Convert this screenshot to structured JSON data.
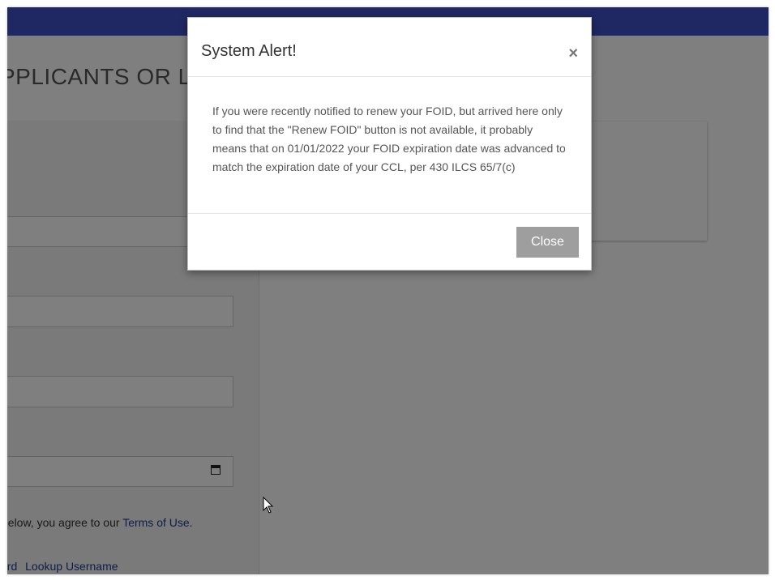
{
  "page": {
    "heading": "PPLICANTS OR L",
    "terms_prefix": "below, you agree to our ",
    "terms_link": "Terms of Use",
    "terms_suffix": ".",
    "link_password": "ord",
    "link_username": "Lookup Username"
  },
  "modal": {
    "title": "System Alert!",
    "close_x": "×",
    "body": "If you were recently notified to renew your FOID, but arrived here only to find that the \"Renew FOID\" button is not available, it probably means that on 01/01/2022 your FOID expiration date was advanced to match the expiration date of your CCL, per 430 ILCS 65/7(c)",
    "close_button": "Close"
  },
  "colors": {
    "topbar": "#3f51c4",
    "link": "#1f3a93",
    "close_button": "#9e9e9e"
  },
  "icons": [
    "calendar-icon",
    "mouse-cursor-icon",
    "close-icon"
  ]
}
